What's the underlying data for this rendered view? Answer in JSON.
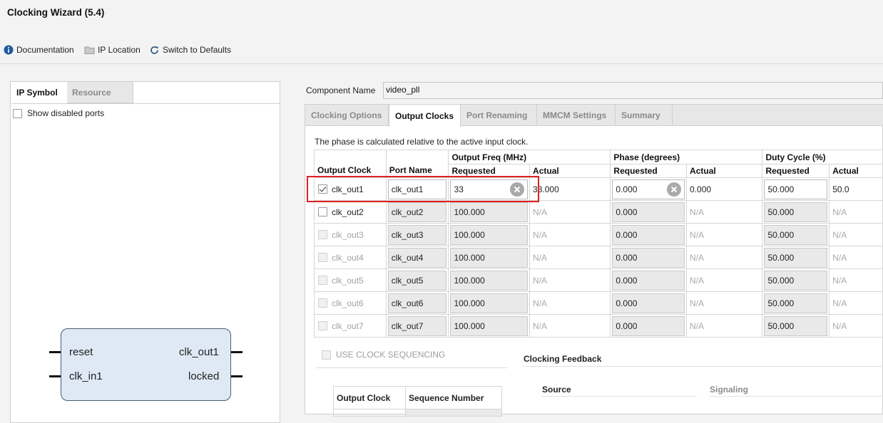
{
  "window": {
    "title": "Clocking Wizard (5.4)"
  },
  "toolbar": {
    "documentation": "Documentation",
    "ip_location": "IP Location",
    "switch_defaults": "Switch to Defaults"
  },
  "left": {
    "tabs": [
      "IP Symbol",
      "Resource"
    ],
    "show_disabled_ports": "Show disabled ports",
    "symbol": {
      "in_pins": [
        "reset",
        "clk_in1"
      ],
      "out_pins": [
        "clk_out1",
        "locked"
      ]
    }
  },
  "component": {
    "label": "Component Name",
    "value": "video_pll"
  },
  "tabs": [
    "Clocking Options",
    "Output Clocks",
    "Port Renaming",
    "MMCM Settings",
    "Summary"
  ],
  "info_text": "The phase is calculated relative to the active input clock.",
  "table": {
    "headers": {
      "output_clock": "Output Clock",
      "port_name": "Port Name",
      "freq": "Output Freq (MHz)",
      "phase": "Phase (degrees)",
      "duty": "Duty Cycle (%)",
      "requested": "Requested",
      "actual": "Actual"
    },
    "rows": [
      {
        "clock": "clk_out1",
        "port": "clk_out1",
        "freq_req": "33",
        "freq_act": "33.000",
        "phase_req": "0.000",
        "phase_act": "0.000",
        "duty_req": "50.000",
        "duty_act": "50.0"
      },
      {
        "clock": "clk_out2",
        "port": "clk_out2",
        "freq_req": "100.000",
        "freq_act": "N/A",
        "phase_req": "0.000",
        "phase_act": "N/A",
        "duty_req": "50.000",
        "duty_act": "N/A"
      },
      {
        "clock": "clk_out3",
        "port": "clk_out3",
        "freq_req": "100.000",
        "freq_act": "N/A",
        "phase_req": "0.000",
        "phase_act": "N/A",
        "duty_req": "50.000",
        "duty_act": "N/A"
      },
      {
        "clock": "clk_out4",
        "port": "clk_out4",
        "freq_req": "100.000",
        "freq_act": "N/A",
        "phase_req": "0.000",
        "phase_act": "N/A",
        "duty_req": "50.000",
        "duty_act": "N/A"
      },
      {
        "clock": "clk_out5",
        "port": "clk_out5",
        "freq_req": "100.000",
        "freq_act": "N/A",
        "phase_req": "0.000",
        "phase_act": "N/A",
        "duty_req": "50.000",
        "duty_act": "N/A"
      },
      {
        "clock": "clk_out6",
        "port": "clk_out6",
        "freq_req": "100.000",
        "freq_act": "N/A",
        "phase_req": "0.000",
        "phase_act": "N/A",
        "duty_req": "50.000",
        "duty_act": "N/A"
      },
      {
        "clock": "clk_out7",
        "port": "clk_out7",
        "freq_req": "100.000",
        "freq_act": "N/A",
        "phase_req": "0.000",
        "phase_act": "N/A",
        "duty_req": "50.000",
        "duty_act": "N/A"
      }
    ]
  },
  "sequencing": {
    "checkbox_label": "USE CLOCK SEQUENCING",
    "col_output_clock": "Output Clock",
    "col_sequence": "Sequence Number"
  },
  "feedback": {
    "title": "Clocking Feedback",
    "source": "Source",
    "signaling": "Signaling"
  },
  "colors": {
    "highlight": "#e02020",
    "info_icon": "#1f5c9e",
    "block_fill": "#dfe9f6"
  }
}
